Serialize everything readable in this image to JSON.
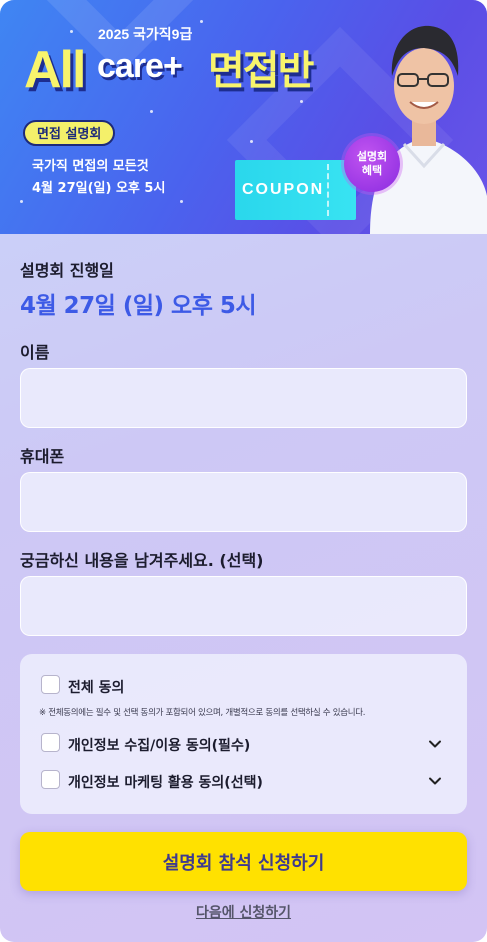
{
  "banner": {
    "year_label": "2025 국가직9급",
    "title_all": "All",
    "title_care": "care+",
    "title_korean": "면접반",
    "pill_label": "면접 설명회",
    "subtitle_line1": "국가직 면접의 모든것",
    "subtitle_line2": "4월 27일(일) 오후 5시",
    "coupon_text": "COUPON",
    "badge_line1": "설명회",
    "badge_line2": "혜택"
  },
  "session": {
    "label": "설명회 진행일",
    "date": "4월 27일 (일) 오후 5시"
  },
  "form": {
    "name_label": "이름",
    "name_value": "",
    "phone_label": "휴대폰",
    "phone_value": "",
    "question_label": "궁금하신 내용을 남겨주세요. (선택)",
    "question_value": ""
  },
  "agreements": {
    "all_label": "전체 동의",
    "note": "※ 전체동의에는 필수 및 선택 동의가 포함되어 있으며, 개별적으로 동의를 선택하실 수 있습니다.",
    "privacy_label": "개인정보 수집/이용 동의(필수)",
    "marketing_label": "개인정보 마케팅 활용 동의(선택)"
  },
  "actions": {
    "submit_label": "설명회 참석 신청하기",
    "later_label": "다음에 신청하기"
  },
  "colors": {
    "accent_blue": "#3d5ae6",
    "submit_yellow": "#ffe100",
    "banner_yellow": "#f8f46c",
    "coupon_cyan": "#2ad7ec",
    "badge_purple": "#8a2be0"
  }
}
